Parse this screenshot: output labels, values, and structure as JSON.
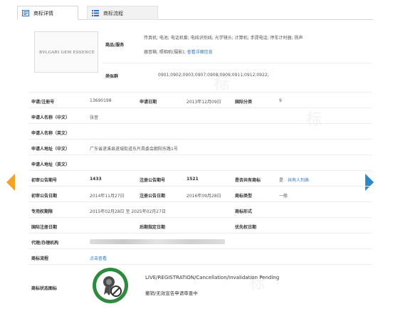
{
  "tabs": [
    {
      "label": "商标详情",
      "active": true
    },
    {
      "label": "商标流程",
      "active": false
    }
  ],
  "trademark": {
    "logo_text": "BVLGARI GEM ESSENCE",
    "goods_label": "商品/服务",
    "goods_line1": "传真机; 电池; 电话机套; 电线识别线; 光学镜头; 计算机; 手提电话; 停车计时器; 扬声",
    "goods_line2": "器音箱; 照相机(摄影);",
    "goods_link": "查看详细信息",
    "similar_label": "类似群",
    "similar_value": "0901;0902;0903;0907;0908;0909;0911;0912;0922;"
  },
  "fields": {
    "reg_no_label": "申请/注册号",
    "reg_no": "13690198",
    "app_date_label": "申请日期",
    "app_date": "2013年12月09日",
    "intl_class_label": "国际分类",
    "intl_class": "9",
    "applicant_cn_label": "申请人名称（中文）",
    "applicant_cn": "张音",
    "applicant_en_label": "申请人名称（英文）",
    "addr_cn_label": "申请人地址（中文）",
    "addr_cn": "广东省遂溪县遂城街道东片昌委会朝阳东路1号",
    "addr_en_label": "申请人地址（英文）",
    "prelim_no_label": "初审公告期号",
    "prelim_no": "1433",
    "reg_pub_no_label": "注册公告期号",
    "reg_pub_no": "1521",
    "shared_label": "是否共有商标",
    "shared_value": "是",
    "shared_link": "共有人列表",
    "prelim_date_label": "初审公告日期",
    "prelim_date": "2014年11月27日",
    "reg_pub_date_label": "注册公告日期",
    "reg_pub_date": "2016年09月28日",
    "tm_type_label": "商标类型",
    "tm_type": "一般",
    "excl_label": "专用权期限",
    "excl_value": "2015年02月28日 至 2025年02月27日",
    "tm_form_label": "商标形式",
    "intl_reg_label": "国际注册日期",
    "later_label": "后期指定日期",
    "priority_label": "优先权日期",
    "agent_label": "代理/办理机构",
    "flow_label": "商标流程",
    "flow_link": "点击查看",
    "status_label": "商标状态图标",
    "status_en": "LIVE/REGISTRATION/Cancellation/Invalidation Pending",
    "status_cn": "撤销/无效宣告申请审查中"
  },
  "colors": {
    "accent_blue": "#2b88c9",
    "accent_orange": "#f0a526",
    "status_green": "#2e8b3d"
  },
  "icons": {
    "prev": "chevron-left-icon",
    "next": "chevron-right-icon",
    "status": "seal-prohibited-icon"
  }
}
